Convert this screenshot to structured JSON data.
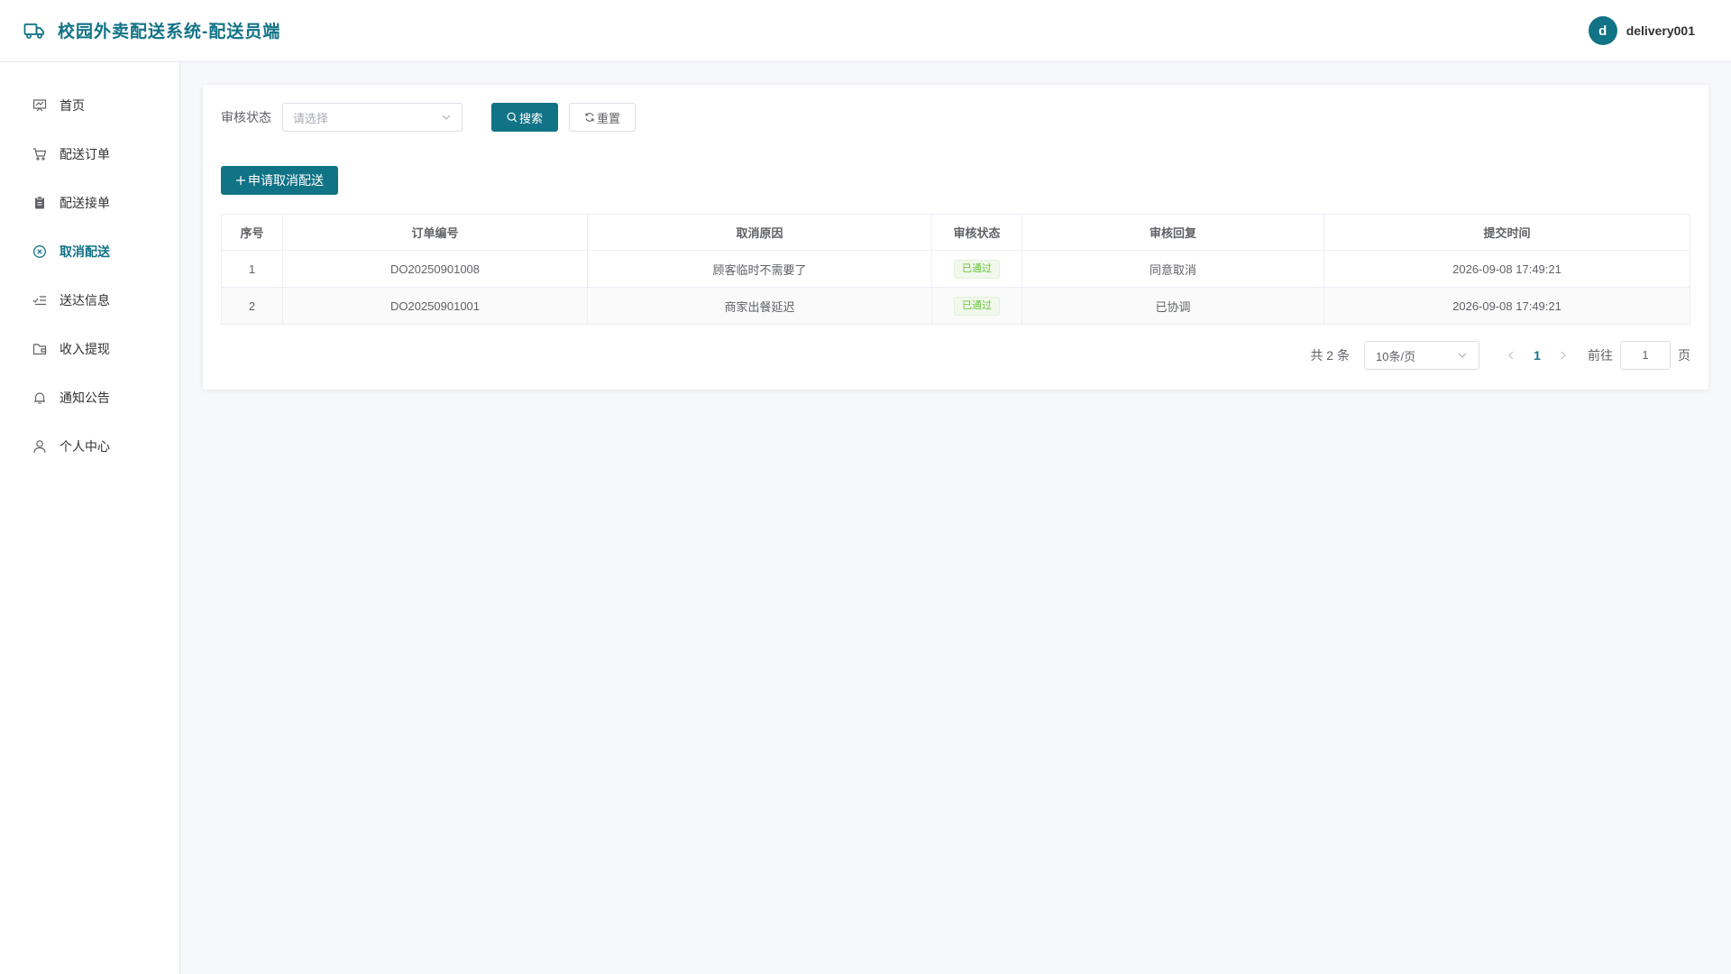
{
  "header": {
    "title": "校园外卖配送系统-配送员端",
    "avatar_letter": "d",
    "username": "delivery001"
  },
  "sidebar": {
    "items": [
      {
        "label": "首页",
        "icon": "home-chart-icon"
      },
      {
        "label": "配送订单",
        "icon": "cart-icon"
      },
      {
        "label": "配送接单",
        "icon": "clipboard-icon"
      },
      {
        "label": "取消配送",
        "icon": "circle-close-icon",
        "active": true
      },
      {
        "label": "送达信息",
        "icon": "check-list-icon"
      },
      {
        "label": "收入提现",
        "icon": "wallet-folder-icon"
      },
      {
        "label": "通知公告",
        "icon": "bell-icon"
      },
      {
        "label": "个人中心",
        "icon": "user-icon"
      }
    ]
  },
  "filter": {
    "status_label": "审核状态",
    "status_placeholder": "请选择",
    "search_label": "搜索",
    "reset_label": "重置"
  },
  "add_button_label": "申请取消配送",
  "table": {
    "headers": [
      "序号",
      "订单编号",
      "取消原因",
      "审核状态",
      "审核回复",
      "提交时间"
    ],
    "rows": [
      {
        "index": "1",
        "order_no": "DO20250901008",
        "reason": "顾客临时不需要了",
        "status": "已通过",
        "reply": "同意取消",
        "time": "2026-09-08 17:49:21"
      },
      {
        "index": "2",
        "order_no": "DO20250901001",
        "reason": "商家出餐延迟",
        "status": "已通过",
        "reply": "已协调",
        "time": "2026-09-08 17:49:21"
      }
    ]
  },
  "pagination": {
    "total_text": "共 2 条",
    "page_size": "10条/页",
    "current_page": "1",
    "goto_label": "前往",
    "goto_value": "1",
    "page_suffix": "页"
  },
  "colors": {
    "primary": "#117386",
    "success_tag": "#67c23a"
  }
}
